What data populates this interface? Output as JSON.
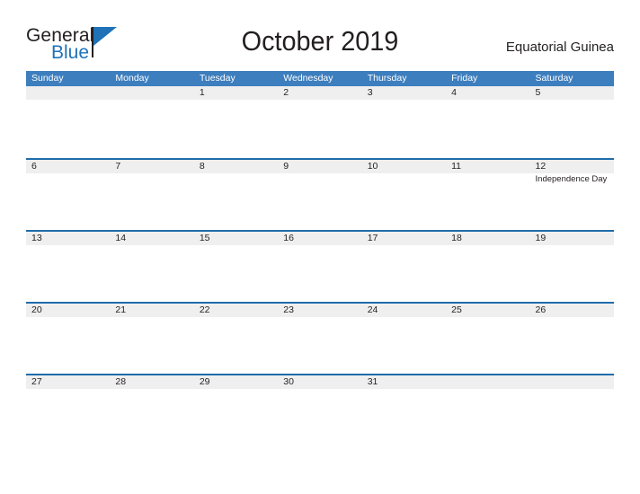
{
  "brand": {
    "name_part1": "General",
    "name_part2": "Blue",
    "accent_color": "#1f72b8"
  },
  "header": {
    "title": "October 2019",
    "country": "Equatorial Guinea"
  },
  "calendar": {
    "month": "October",
    "year": "2019",
    "header_bg": "#3d7ebe",
    "row_rule_color": "#1f6cab",
    "date_band_color": "#efefef",
    "weekdays": [
      "Sunday",
      "Monday",
      "Tuesday",
      "Wednesday",
      "Thursday",
      "Friday",
      "Saturday"
    ],
    "weeks": [
      [
        {
          "date": "",
          "events": []
        },
        {
          "date": "",
          "events": []
        },
        {
          "date": "1",
          "events": []
        },
        {
          "date": "2",
          "events": []
        },
        {
          "date": "3",
          "events": []
        },
        {
          "date": "4",
          "events": []
        },
        {
          "date": "5",
          "events": []
        }
      ],
      [
        {
          "date": "6",
          "events": []
        },
        {
          "date": "7",
          "events": []
        },
        {
          "date": "8",
          "events": []
        },
        {
          "date": "9",
          "events": []
        },
        {
          "date": "10",
          "events": []
        },
        {
          "date": "11",
          "events": []
        },
        {
          "date": "12",
          "events": [
            "Independence Day"
          ]
        }
      ],
      [
        {
          "date": "13",
          "events": []
        },
        {
          "date": "14",
          "events": []
        },
        {
          "date": "15",
          "events": []
        },
        {
          "date": "16",
          "events": []
        },
        {
          "date": "17",
          "events": []
        },
        {
          "date": "18",
          "events": []
        },
        {
          "date": "19",
          "events": []
        }
      ],
      [
        {
          "date": "20",
          "events": []
        },
        {
          "date": "21",
          "events": []
        },
        {
          "date": "22",
          "events": []
        },
        {
          "date": "23",
          "events": []
        },
        {
          "date": "24",
          "events": []
        },
        {
          "date": "25",
          "events": []
        },
        {
          "date": "26",
          "events": []
        }
      ],
      [
        {
          "date": "27",
          "events": []
        },
        {
          "date": "28",
          "events": []
        },
        {
          "date": "29",
          "events": []
        },
        {
          "date": "30",
          "events": []
        },
        {
          "date": "31",
          "events": []
        },
        {
          "date": "",
          "events": []
        },
        {
          "date": "",
          "events": []
        }
      ]
    ]
  }
}
